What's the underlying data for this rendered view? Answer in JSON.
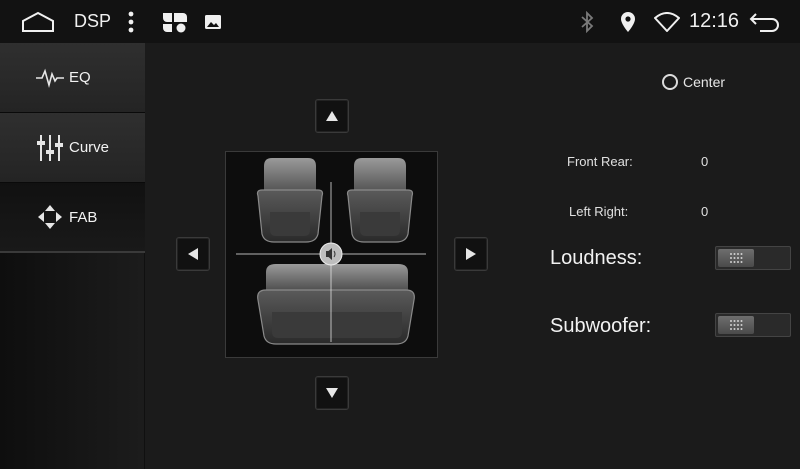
{
  "status_bar": {
    "app_title": "DSP",
    "time": "12:16",
    "icons": [
      "home-icon",
      "more-vert-icon",
      "apps-icon",
      "gallery-icon",
      "bluetooth-icon",
      "location-icon",
      "wifi-icon",
      "back-icon"
    ]
  },
  "sidebar": {
    "items": [
      {
        "label": "EQ",
        "icon": "eq-wave-icon",
        "active": false
      },
      {
        "label": "Curve",
        "icon": "sliders-icon",
        "active": false
      },
      {
        "label": "FAB",
        "icon": "fader-arrows-icon",
        "active": true
      }
    ]
  },
  "fab": {
    "center_label": "Center",
    "center_selected": false,
    "front_rear_label": "Front Rear:",
    "front_rear_value": "0",
    "left_right_label": "Left Right:",
    "left_right_value": "0",
    "loudness_label": "Loudness:",
    "loudness_on": false,
    "subwoofer_label": "Subwoofer:",
    "subwoofer_on": false
  },
  "colors": {
    "background": "#1b1b1b",
    "status_bar": "#121212",
    "text": "#e8e8e8"
  }
}
